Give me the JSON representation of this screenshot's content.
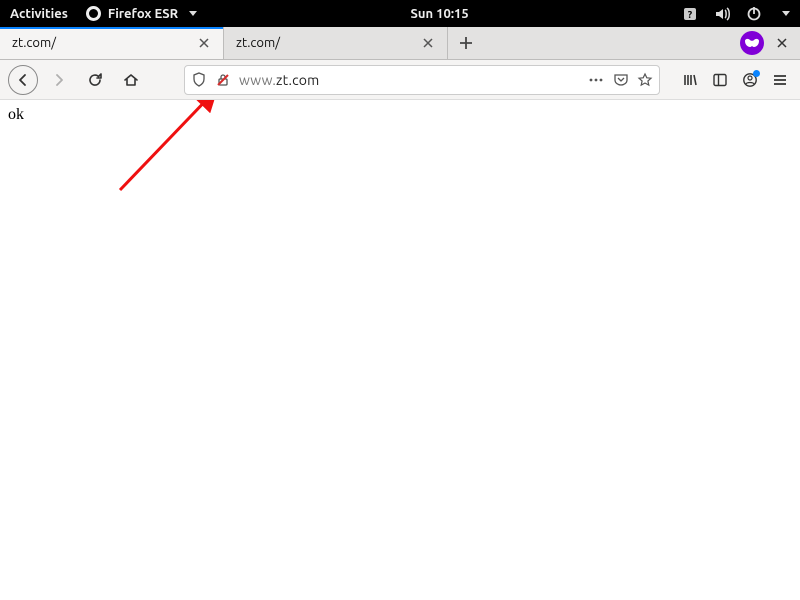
{
  "topbar": {
    "activities": "Activities",
    "app_name": "Firefox ESR",
    "clock": "Sun 10:15"
  },
  "tabs": [
    {
      "title": "zt.com/",
      "active": true
    },
    {
      "title": "zt.com/",
      "active": false
    }
  ],
  "url": {
    "prefix": "www.",
    "host": "zt.com"
  },
  "page": {
    "body_text": "ok"
  }
}
